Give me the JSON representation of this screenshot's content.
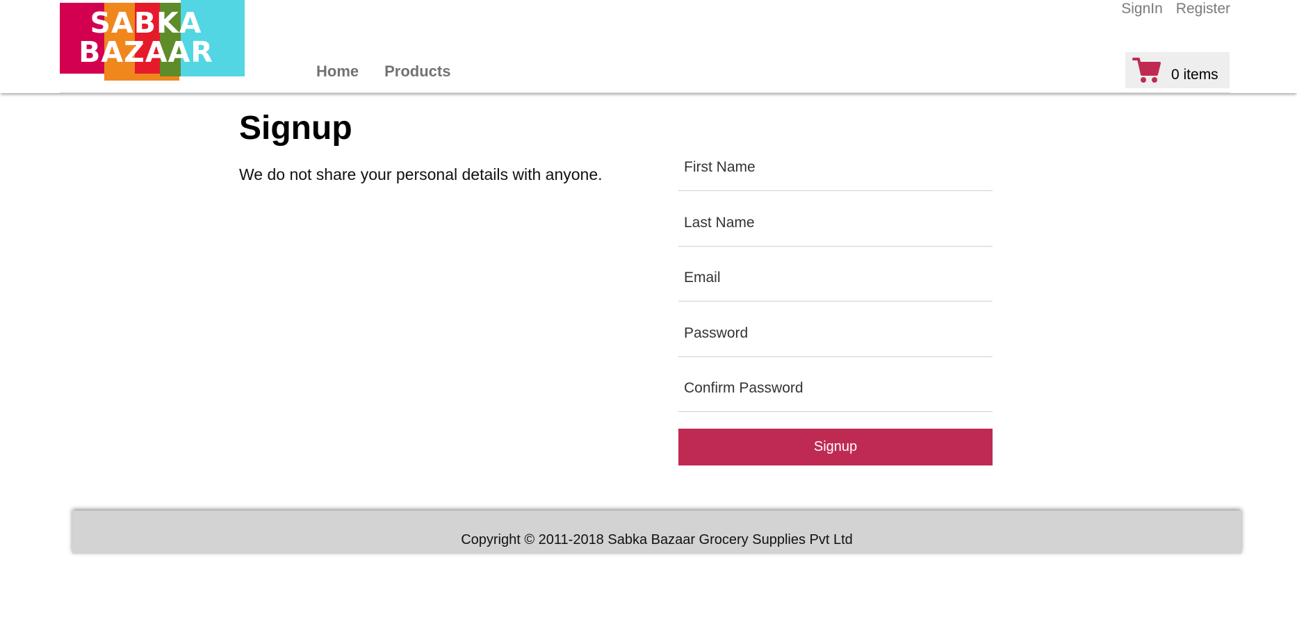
{
  "header": {
    "logo_text": "SABKA BAZAAR",
    "logo_line1": "SABKA",
    "logo_line2": "BAZAAR",
    "nav": [
      {
        "label": "Home"
      },
      {
        "label": "Products"
      }
    ],
    "auth": {
      "signin_label": "SignIn",
      "register_label": "Register"
    },
    "cart": {
      "icon": "cart-icon",
      "count_label": "0 items",
      "color": "#bf2a53"
    }
  },
  "main": {
    "title": "Signup",
    "note": "We do not share your personal details with anyone.",
    "form": {
      "fields": [
        {
          "placeholder": "First Name",
          "value": ""
        },
        {
          "placeholder": "Last Name",
          "value": ""
        },
        {
          "placeholder": "Email",
          "value": ""
        },
        {
          "placeholder": "Password",
          "value": ""
        },
        {
          "placeholder": "Confirm Password",
          "value": ""
        }
      ],
      "submit_label": "Signup",
      "submit_color": "#bf2a53"
    }
  },
  "footer": {
    "copyright": "Copyright © 2011-2018 Sabka Bazaar Grocery Supplies Pvt Ltd"
  }
}
